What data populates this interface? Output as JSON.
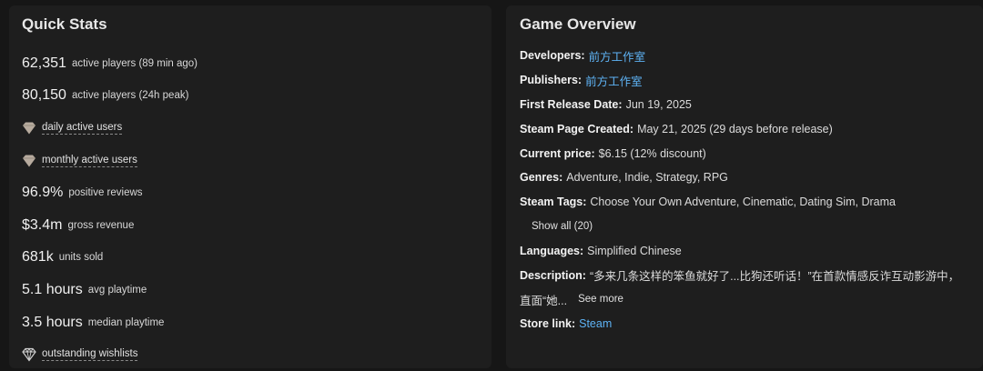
{
  "quick_stats": {
    "title": "Quick Stats",
    "items": [
      {
        "big": "62,351",
        "small": "active players (89 min ago)"
      },
      {
        "big": "80,150",
        "small": "active players (24h peak)"
      },
      {
        "icon": "diamond-icon",
        "small": "daily active users"
      },
      {
        "icon": "diamond-icon",
        "small": "monthly active users"
      },
      {
        "big": "96.9%",
        "small": "positive reviews"
      },
      {
        "big": "$3.4m",
        "small": "gross revenue"
      },
      {
        "big": "681k",
        "small": "units sold"
      },
      {
        "big": "5.1 hours",
        "small": "avg playtime"
      },
      {
        "big": "3.5 hours",
        "small": "median playtime"
      },
      {
        "icon": "gem-icon",
        "small": "outstanding wishlists"
      }
    ]
  },
  "overview": {
    "title": "Game Overview",
    "developers_label": "Developers:",
    "developers_value": "前方工作室",
    "publishers_label": "Publishers:",
    "publishers_value": "前方工作室",
    "release_label": "First Release Date:",
    "release_value": "Jun 19, 2025",
    "created_label": "Steam Page Created:",
    "created_value": "May 21, 2025 (29 days before release)",
    "price_label": "Current price:",
    "price_value": "$6.15 (12% discount)",
    "genres_label": "Genres:",
    "genres_value": "Adventure, Indie, Strategy, RPG",
    "tags_label": "Steam Tags:",
    "tags_value": "Choose Your Own Adventure, Cinematic, Dating Sim, Drama",
    "show_all": "Show all (20)",
    "languages_label": "Languages:",
    "languages_value": "Simplified Chinese",
    "description_label": "Description:",
    "description_line1": "“多来几条这样的笨鱼就好了...比狗还听话！”在首款情感反诈互动影游中，",
    "description_line2": "直面“她...",
    "see_more": "See more",
    "store_label": "Store link:",
    "store_value": "Steam"
  },
  "colors": {
    "link": "#5eb3f5",
    "background": "#161616",
    "panel": "#1e1e1e"
  }
}
